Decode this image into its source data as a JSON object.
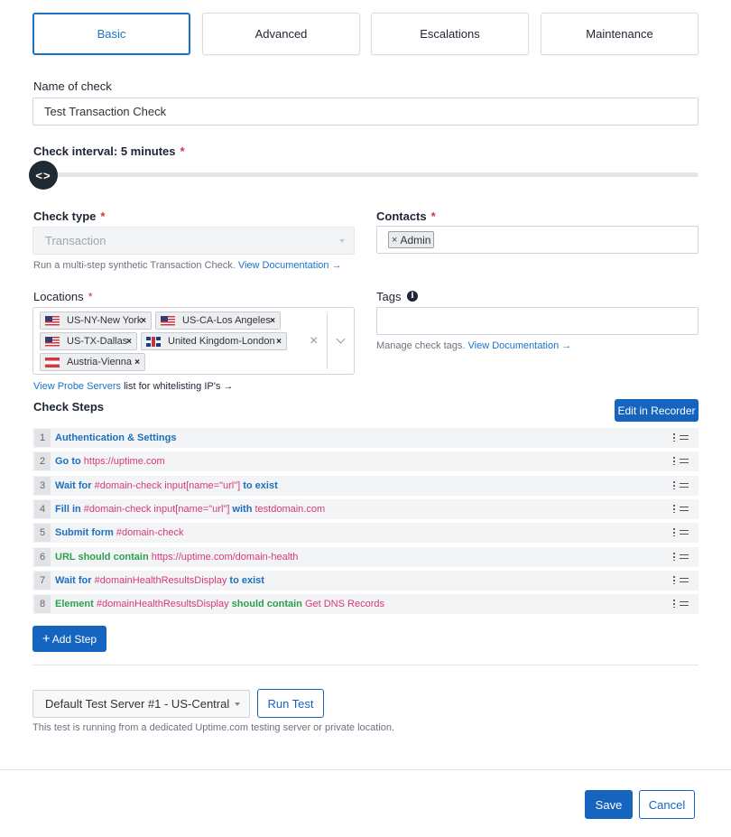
{
  "tabs": [
    {
      "label": "Basic",
      "active": true
    },
    {
      "label": "Advanced",
      "active": false
    },
    {
      "label": "Escalations",
      "active": false
    },
    {
      "label": "Maintenance",
      "active": false
    }
  ],
  "name_of_check": {
    "label": "Name of check",
    "value": "Test Transaction Check"
  },
  "check_interval": {
    "label": "Check interval: 5 minutes",
    "required_mark": "*"
  },
  "check_type": {
    "label": "Check type",
    "required_mark": "*",
    "value": "Transaction",
    "help": "Run a multi-step synthetic Transaction Check.",
    "help_link": "View Documentation →"
  },
  "contacts": {
    "label": "Contacts",
    "required_mark": "*",
    "chips": [
      {
        "label": "Admin",
        "remove": "×"
      }
    ]
  },
  "locations": {
    "label": "Locations",
    "required_mark": "*",
    "chips": [
      {
        "label": "US-NY-New York",
        "flag": "us"
      },
      {
        "label": "US-CA-Los Angeles",
        "flag": "us"
      },
      {
        "label": "US-TX-Dallas",
        "flag": "us"
      },
      {
        "label": "United Kingdom-London",
        "flag": "uk"
      },
      {
        "label": "Austria-Vienna",
        "flag": "at"
      }
    ],
    "remove_glyph": "×",
    "clear_glyph": "×",
    "probe_link": "View Probe Servers",
    "probe_text": "list for whitelisting IP's →"
  },
  "tags": {
    "label": "Tags",
    "info_icon": "i",
    "help": "Manage check tags.",
    "help_link": "View Documentation →"
  },
  "check_steps": {
    "title": "Check Steps",
    "edit_recorder_label": "Edit in Recorder",
    "steps": [
      {
        "num": "1",
        "parts": [
          {
            "t": "Authentication & Settings",
            "c": "kw-blue"
          }
        ]
      },
      {
        "num": "2",
        "parts": [
          {
            "t": "Go to ",
            "c": "kw-blue"
          },
          {
            "t": "https://uptime.com",
            "c": "val"
          }
        ]
      },
      {
        "num": "3",
        "parts": [
          {
            "t": "Wait for ",
            "c": "kw-blue"
          },
          {
            "t": "#domain-check input[name=\"url\"]",
            "c": "val"
          },
          {
            "t": " to exist",
            "c": "kw-blue"
          }
        ]
      },
      {
        "num": "4",
        "parts": [
          {
            "t": "Fill in ",
            "c": "kw-blue"
          },
          {
            "t": "#domain-check input[name=\"url\"]",
            "c": "val"
          },
          {
            "t": " with ",
            "c": "kw-blue"
          },
          {
            "t": "testdomain.com",
            "c": "val"
          }
        ]
      },
      {
        "num": "5",
        "parts": [
          {
            "t": "Submit form ",
            "c": "kw-blue"
          },
          {
            "t": "#domain-check",
            "c": "val"
          }
        ]
      },
      {
        "num": "6",
        "parts": [
          {
            "t": "URL should contain ",
            "c": "kw-green"
          },
          {
            "t": "https://uptime.com/domain-health",
            "c": "val"
          }
        ]
      },
      {
        "num": "7",
        "parts": [
          {
            "t": "Wait for ",
            "c": "kw-blue"
          },
          {
            "t": "#domainHealthResultsDisplay",
            "c": "val"
          },
          {
            "t": " to exist",
            "c": "kw-blue"
          }
        ]
      },
      {
        "num": "8",
        "parts": [
          {
            "t": "Element ",
            "c": "kw-green"
          },
          {
            "t": "#domainHealthResultsDisplay",
            "c": "val"
          },
          {
            "t": " should contain ",
            "c": "kw-green"
          },
          {
            "t": "Get DNS Records",
            "c": "val"
          }
        ]
      }
    ],
    "add_step_label": "Add Step",
    "add_step_icon": "+"
  },
  "test_server": {
    "value": "Default Test Server #1 - US-Central",
    "run_label": "Run Test",
    "help": "This test is running from a dedicated Uptime.com testing server or private location."
  },
  "footer": {
    "save_label": "Save",
    "cancel_label": "Cancel"
  },
  "colors": {
    "accent": "#1565c0",
    "required": "#d6353e",
    "step_value": "#d63a78",
    "step_keyword_blue": "#1a6fbf",
    "step_keyword_green": "#2e9e4f"
  },
  "icons": {
    "slider_handle": "<>",
    "info": "info-icon",
    "dots": "kebab-icon",
    "grip": "drag-handle-icon"
  }
}
